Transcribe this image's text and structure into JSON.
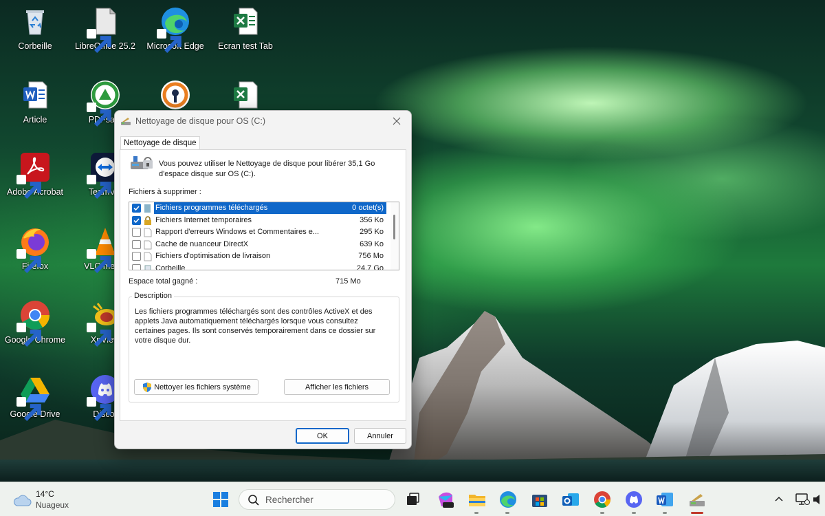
{
  "desktop": {
    "icons": [
      {
        "label": "Corbeille",
        "icon": "recycle-bin-icon"
      },
      {
        "label": "LibreOffice 25.2",
        "icon": "libreoffice-icon"
      },
      {
        "label": "Microsoft Edge",
        "icon": "edge-icon"
      },
      {
        "label": "Ecran test Tab",
        "icon": "excel-file-icon"
      },
      {
        "label": "Article",
        "icon": "word-file-icon"
      },
      {
        "label": "PDFsam",
        "icon": "pdfsam-icon"
      },
      {
        "label": "",
        "icon": "openvpn-icon"
      },
      {
        "label": "",
        "icon": "excel-file-icon"
      },
      {
        "label": "Adobe Acrobat",
        "icon": "acrobat-icon"
      },
      {
        "label": "TeamVie",
        "icon": "teamviewer-icon"
      },
      {
        "label": "Firefox",
        "icon": "firefox-icon"
      },
      {
        "label": "VLC media",
        "icon": "vlc-icon"
      },
      {
        "label": "Google Chrome",
        "icon": "chrome-icon"
      },
      {
        "label": "XnView",
        "icon": "xnview-icon"
      },
      {
        "label": "Google Drive",
        "icon": "google-drive-icon"
      },
      {
        "label": "Discor",
        "icon": "discord-icon"
      }
    ]
  },
  "dialog": {
    "title": "Nettoyage de disque pour OS (C:)",
    "tab_label": "Nettoyage de disque",
    "intro": "Vous pouvez utiliser le Nettoyage de disque pour libérer 35,1 Go d'espace disque sur OS (C:).",
    "files_label": "Fichiers à supprimer :",
    "files": [
      {
        "name": "Fichiers programmes téléchargés",
        "size": "0 octet(s)",
        "checked": true,
        "selected": true
      },
      {
        "name": "Fichiers Internet temporaires",
        "size": "356 Ko",
        "checked": true,
        "selected": false
      },
      {
        "name": "Rapport d'erreurs Windows et Commentaires e...",
        "size": "295 Ko",
        "checked": false,
        "selected": false
      },
      {
        "name": "Cache de nuanceur DirectX",
        "size": "639 Ko",
        "checked": false,
        "selected": false
      },
      {
        "name": "Fichiers d'optimisation de livraison",
        "size": "756 Mo",
        "checked": false,
        "selected": false
      },
      {
        "name": "Corbeille",
        "size": "24,7 Go",
        "checked": false,
        "selected": false
      }
    ],
    "total_label": "Espace total gagné :",
    "total_value": "715 Mo",
    "description_label": "Description",
    "description": "Les fichiers programmes téléchargés sont des contrôles ActiveX et des applets Java automatiquement téléchargés lorsque vous consultez certaines pages. Ils sont conservés temporairement dans ce dossier sur votre disque dur.",
    "clean_system_button": "Nettoyer les fichiers système",
    "view_files_button": "Afficher les fichiers",
    "ok_button": "OK",
    "cancel_button": "Annuler"
  },
  "taskbar": {
    "weather_temp": "14°C",
    "weather_condition": "Nuageux",
    "search_placeholder": "Rechercher",
    "accent": "#0f67c9"
  }
}
